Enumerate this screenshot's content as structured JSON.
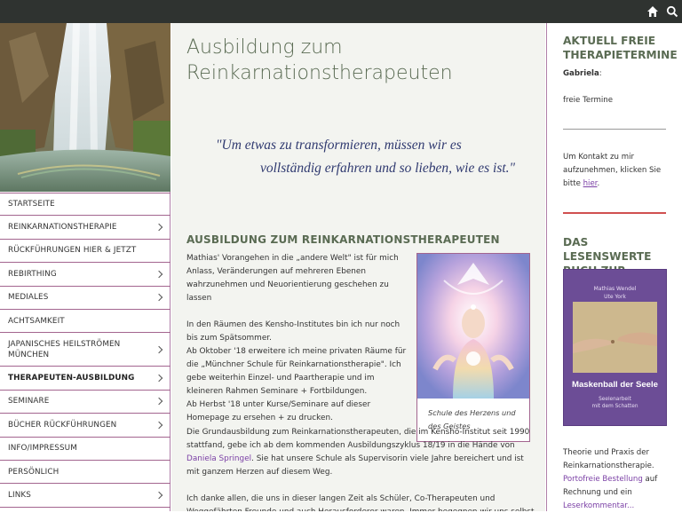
{
  "topbar": {
    "home_icon": "home-icon",
    "search_icon": "search-icon"
  },
  "sidebar": {
    "hero_alt": "waterfall",
    "items": [
      {
        "label": "STARTSEITE",
        "sub": false
      },
      {
        "label": "REINKARNATIONSTHERAPIE",
        "sub": true
      },
      {
        "label": "RÜCKFÜHRUNGEN HIER & JETZT",
        "sub": false
      },
      {
        "label": "REBIRTHING",
        "sub": true
      },
      {
        "label": "MEDIALES",
        "sub": true
      },
      {
        "label": "ACHTSAMKEIT",
        "sub": false
      },
      {
        "label": "JAPANISCHES HEILSTRÖMEN MÜNCHEN",
        "sub": true
      },
      {
        "label": "THERAPEUTEN-AUSBILDUNG",
        "sub": true,
        "active": true
      },
      {
        "label": "SEMINARE",
        "sub": true
      },
      {
        "label": "BÜCHER RÜCKFÜHRUNGEN",
        "sub": true
      },
      {
        "label": "INFO/IMPRESSUM",
        "sub": false
      },
      {
        "label": "PERSÖNLICH",
        "sub": false
      },
      {
        "label": "LINKS",
        "sub": true
      }
    ]
  },
  "main": {
    "title": "Ausbildung zum Reinkarnationstherapeuten",
    "quote_line1": "\"Um etwas zu transformieren, müssen wir es",
    "quote_line2": "vollständig erfahren und so lieben, wie es ist.\"",
    "section_title": "AUSBILDUNG ZUM REINKARNATIONSTHERAPEUTEN",
    "p1": "Mathias' Vorangehen in die „andere Welt\" ist für mich Anlass, Veränderungen auf mehreren Ebenen wahrzunehmen und Neuorientierung geschehen zu lassen",
    "p2a": "In den Räumen des Kensho-Institutes bin ich nur noch bis zum Spätsommer.",
    "p2b": "Ab Oktober '18 erweitere ich meine privaten Räume für die „Münchner Schule für Reinkarnationstherapie\". Ich gebe weiterhin Einzel- und Paartherapie und im kleineren Rahmen Seminare + Fortbildungen.",
    "p2c": "Ab Herbst '18 unter Kurse/Seminare auf dieser Homepage zu ersehen + zu drucken.",
    "p3_pre": "Die Grundausbildung zum Reinkarnationstherapeuten, die im Kensho-Institut seit 1990 stattfand, gebe ich ab dem kommenden Ausbildungszyklus 18/19 in die Hände von ",
    "p3_link": "Daniela Springel",
    "p3_post": ". Sie hat unsere Schule als Supervisorin viele Jahre bereichert und ist mit ganzem Herzen auf diesem Weg.",
    "p4": "Ich danke allen, die uns in dieser langen Zeit als Schüler, Co-Therapeuten und Weggefährten Freunde und auch Herausforderer waren. Immer begegnen wir uns selbst.",
    "figure_caption": "Schule des Herzens und des Geistes"
  },
  "right": {
    "head1": "AKTUELL FREIE THERAPIETERMINE",
    "gabriela": "Gabriela",
    "gabriela_colon": ":",
    "free_link": "freie Termine",
    "contact_pre": "Um Kontakt zu mir aufzunehmen, klicken Sie bitte ",
    "contact_link": "hier",
    "contact_post": ".",
    "head2": "DAS LESENSWERTE BUCH ZUR THERAPIE:",
    "book_authors": "Mathias Wendel\nUte York",
    "book_title": "Maskenball der Seele",
    "book_sub": "Seelenarbeit\nmit dem Schatten",
    "desc": "Theorie und Praxis der Reinkarnationstherapie.",
    "order_link": "Portofreie Bestellung",
    "order_post": " auf Rechnung und ein",
    "comment_link": "Leserkommentar..."
  },
  "colors": {
    "accent": "#a3658f",
    "link": "#7a3fa5",
    "heading": "#5a6b53",
    "quote": "#303a70",
    "topbar": "#2f3330"
  }
}
